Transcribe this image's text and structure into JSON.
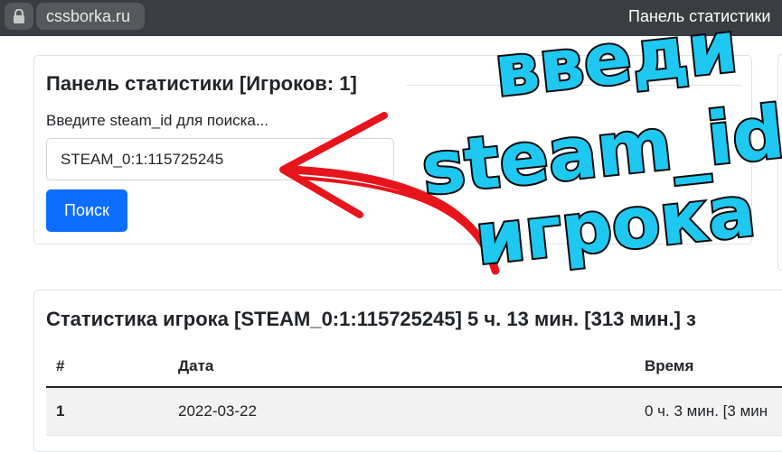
{
  "browser": {
    "url": "cssborka.ru",
    "brand": "Панель статистики"
  },
  "search_panel": {
    "title": "Панель статистики [Игроков: 1]",
    "label": "Введите steam_id для поиска...",
    "input_value": "STEAM_0:1:115725245",
    "button_label": "Поиск"
  },
  "player_stats": {
    "title": "Статистика игрока [STEAM_0:1:115725245] 5 ч. 13 мин. [313 мин.] з",
    "columns": [
      "#",
      "Дата",
      "Время"
    ],
    "rows": [
      [
        "1",
        "2022-03-22",
        "0 ч. 3 мин. [3 мин"
      ]
    ]
  },
  "annotation": {
    "lines": [
      "введи",
      "steam_id",
      "игрока"
    ],
    "text_color": "#1ec8f0",
    "arrow_color": "#e8141b"
  }
}
